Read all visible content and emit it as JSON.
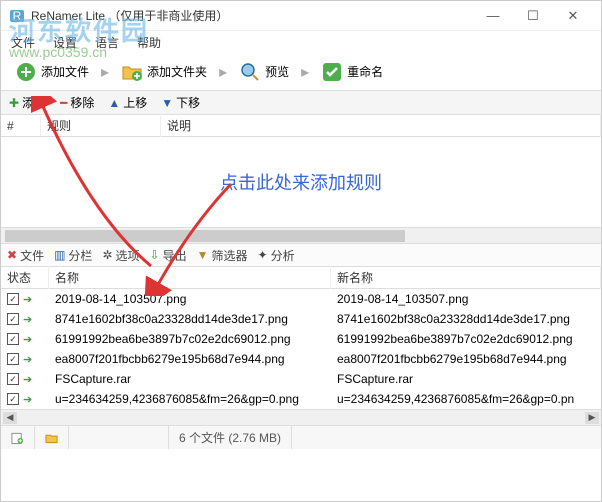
{
  "window": {
    "title": "ReNamer Lite （仅用于非商业使用）",
    "min": "—",
    "max": "☐",
    "close": "✕"
  },
  "menu": {
    "file": "文件",
    "settings": "设置",
    "lang": "语言",
    "help": "帮助"
  },
  "toolbar": {
    "add_files": "添加文件",
    "add_folders": "添加文件夹",
    "preview": "预览",
    "rename": "重命名"
  },
  "rules_tb": {
    "add": "添加",
    "remove": "移除",
    "up": "上移",
    "down": "下移"
  },
  "rules_hdr": {
    "num": "#",
    "rule": "规则",
    "desc": "说明"
  },
  "rules_hint": "点击此处来添加规则",
  "files_tb": {
    "file": "文件",
    "cols": "分栏",
    "opts": "选项",
    "export": "导出",
    "filter": "筛选器",
    "analyze": "分析"
  },
  "files_hdr": {
    "state": "状态",
    "name": "名称",
    "newname": "新名称"
  },
  "files": [
    {
      "name": "2019-08-14_103507.png",
      "newname": "2019-08-14_103507.png"
    },
    {
      "name": "8741e1602bf38c0a23328dd14de3de17.png",
      "newname": "8741e1602bf38c0a23328dd14de3de17.png"
    },
    {
      "name": "61991992bea6be3897b7c02e2dc69012.png",
      "newname": "61991992bea6be3897b7c02e2dc69012.png"
    },
    {
      "name": "ea8007f201fbcbb6279e195b68d7e944.png",
      "newname": "ea8007f201fbcbb6279e195b68d7e944.png"
    },
    {
      "name": "FSCapture.rar",
      "newname": "FSCapture.rar"
    },
    {
      "name": "u=234634259,4236876085&fm=26&gp=0.png",
      "newname": "u=234634259,4236876085&fm=26&gp=0.pn"
    }
  ],
  "status": {
    "count": "6 个文件 (2.76 MB)"
  },
  "watermark": {
    "line1": "河东软件园",
    "line2": "www.pc0359.cn"
  }
}
